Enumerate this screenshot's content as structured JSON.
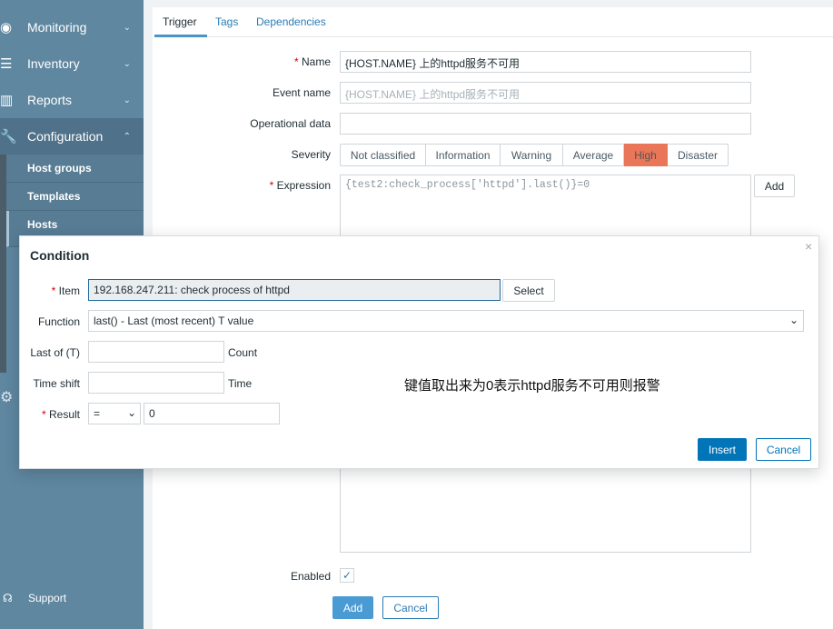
{
  "sidebar": {
    "menus": [
      {
        "label": "Monitoring",
        "icon": "eye-icon"
      },
      {
        "label": "Inventory",
        "icon": "list-icon"
      },
      {
        "label": "Reports",
        "icon": "bar-chart-icon"
      },
      {
        "label": "Configuration",
        "icon": "wrench-icon"
      }
    ],
    "sub_items": [
      "Host groups",
      "Templates",
      "Hosts"
    ],
    "support": "Support"
  },
  "tabs": [
    "Trigger",
    "Tags",
    "Dependencies"
  ],
  "form": {
    "name_label": "Name",
    "name_value": "{HOST.NAME} 上的httpd服务不可用",
    "event_label": "Event name",
    "event_placeholder": "{HOST.NAME} 上的httpd服务不可用",
    "opdata_label": "Operational data",
    "opdata_value": "",
    "severity_label": "Severity",
    "severity_options": [
      "Not classified",
      "Information",
      "Warning",
      "Average",
      "High",
      "Disaster"
    ],
    "severity_selected": "High",
    "severity_high_color": "#e97659",
    "expression_label": "Expression",
    "expression_value": "{test2:check_process['httpd'].last()}=0",
    "expression_add": "Add",
    "enabled_label": "Enabled",
    "enabled": true,
    "add_button": "Add",
    "cancel_button": "Cancel"
  },
  "dialog": {
    "title": "Condition",
    "item_label": "Item",
    "item_value": "192.168.247.211: check process of httpd",
    "select_button": "Select",
    "function_label": "Function",
    "function_value": "last() - Last (most recent) T value",
    "lastof_label": "Last of (T)",
    "lastof_value": "",
    "lastof_unit": "Count",
    "timeshift_label": "Time shift",
    "timeshift_value": "",
    "timeshift_unit": "Time",
    "result_label": "Result",
    "result_operator": "=",
    "result_value": "0",
    "annotation": "键值取出来为0表示httpd服务不可用则报警",
    "insert_button": "Insert",
    "cancel_button": "Cancel",
    "close": "×",
    "accent": "#0275b8"
  }
}
